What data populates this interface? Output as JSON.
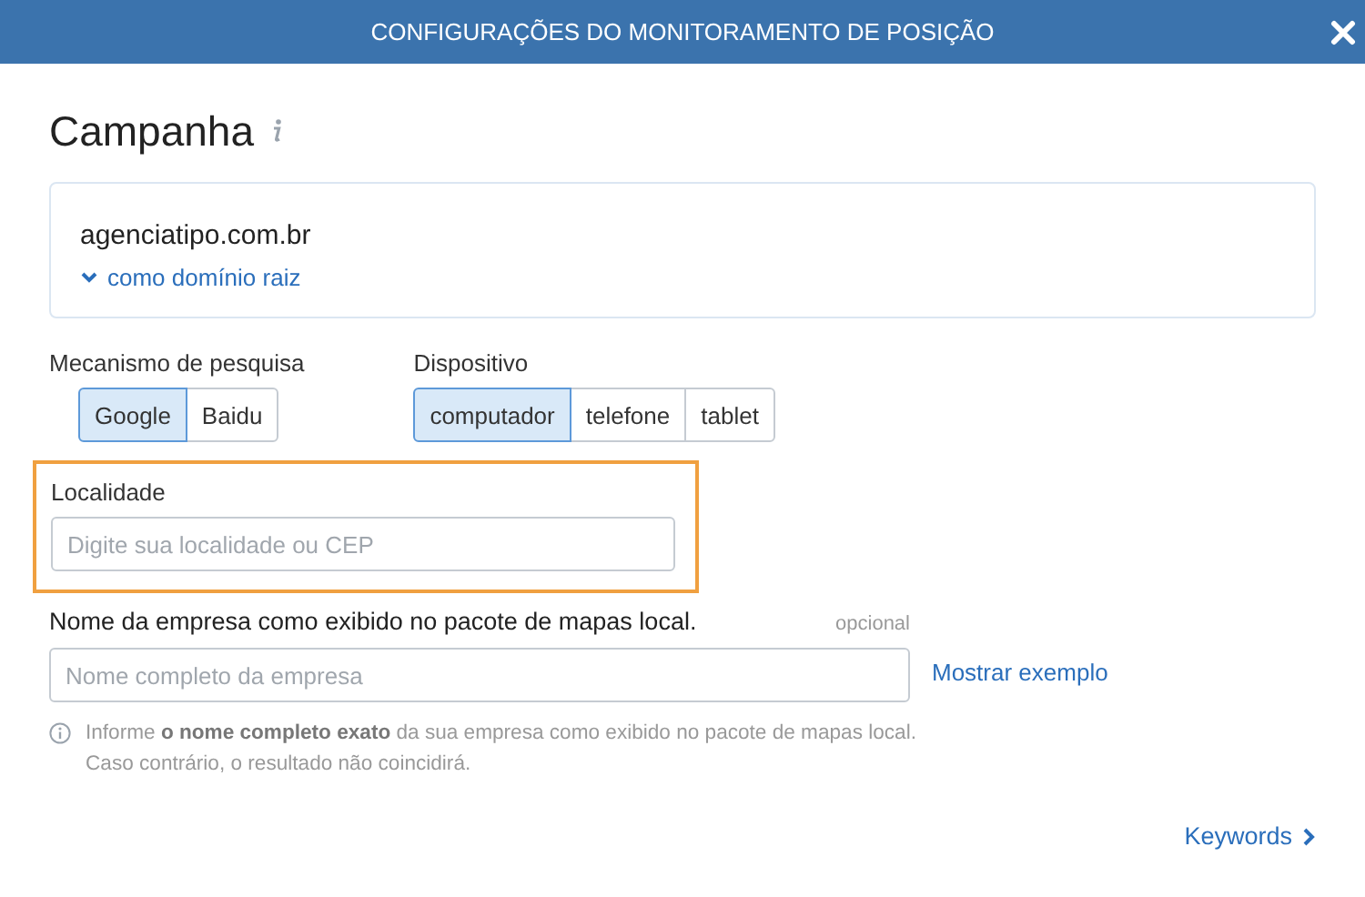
{
  "window": {
    "title": "CONFIGURAÇÕES DO MONITORAMENTO DE POSIÇÃO"
  },
  "heading": "Campanha",
  "domain": {
    "name": "agenciatipo.com.br",
    "scope": "como domínio raiz"
  },
  "search_engine": {
    "label": "Mecanismo de pesquisa",
    "options": [
      {
        "label": "Google",
        "selected": true
      },
      {
        "label": "Baidu",
        "selected": false
      }
    ]
  },
  "device": {
    "label": "Dispositivo",
    "options": [
      {
        "label": "computador",
        "selected": true
      },
      {
        "label": "telefone",
        "selected": false
      },
      {
        "label": "tablet",
        "selected": false
      }
    ]
  },
  "location": {
    "label": "Localidade",
    "placeholder": "Digite sua localidade ou CEP",
    "highlighted": true
  },
  "business": {
    "label": "Nome da empresa como exibido no pacote de mapas local.",
    "optional": "opcional",
    "placeholder": "Nome completo da empresa",
    "example_link": "Mostrar exemplo",
    "help": [
      "Informe **o nome completo exato** da sua empresa como exibido no pacote de mapas local.",
      "Caso contrário, o resultado não coincidirá."
    ]
  },
  "next_link": "Keywords"
}
